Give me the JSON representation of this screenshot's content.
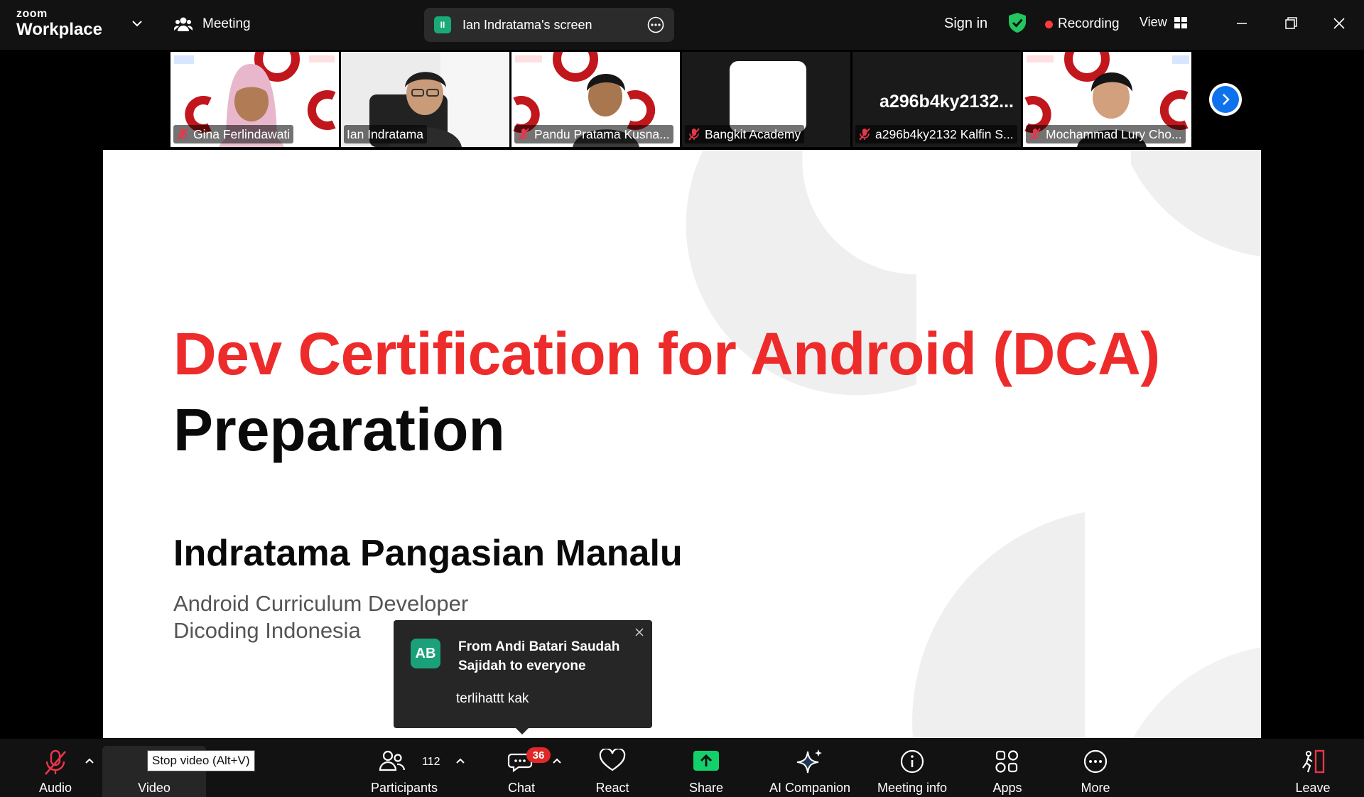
{
  "topbar": {
    "logo_line1": "zoom",
    "logo_line2": "Workplace",
    "meeting_label": "Meeting",
    "share_badge": "II",
    "share_title": "Ian Indratama's screen",
    "sign_in": "Sign in",
    "recording": "Recording",
    "view": "View",
    "colors": {
      "recording_dot": "#ff3a3a",
      "shield": "#22c55e",
      "share_badge": "#1aaa78"
    }
  },
  "thumbnails": [
    {
      "name": "Gina Ferlindawati",
      "muted": true,
      "active": false
    },
    {
      "name": "Ian Indratama",
      "muted": false,
      "active": true
    },
    {
      "name": "Pandu Pratama Kusna...",
      "muted": true,
      "active": false
    },
    {
      "name": "Bangkit Academy",
      "muted": true,
      "active": false
    },
    {
      "name": "a296b4ky2132 Kalfin S...",
      "muted": true,
      "active": false,
      "big_label": "a296b4ky2132..."
    },
    {
      "name": "Mochammad Lury Cho...",
      "muted": true,
      "active": false
    }
  ],
  "slide": {
    "title_line1": "Dev Certification for Android (DCA)",
    "title_line2": "Preparation",
    "presenter": "Indratama Pangasian Manalu",
    "role": "Android Curriculum Developer",
    "org": "Dicoding Indonesia",
    "colors": {
      "title_red": "#ee2b2b"
    }
  },
  "chat_toast": {
    "avatar_initials": "AB",
    "from": "From Andi Batari Saudah Sajidah to everyone",
    "message": "terlihattt kak"
  },
  "toolbar": {
    "audio": "Audio",
    "video": "Video",
    "video_tooltip": "Stop video (Alt+V)",
    "participants": "Participants",
    "participants_count": "112",
    "chat": "Chat",
    "chat_badge": "36",
    "react": "React",
    "share": "Share",
    "ai_companion": "AI Companion",
    "meeting_info": "Meeting info",
    "apps": "Apps",
    "more": "More",
    "leave": "Leave",
    "colors": {
      "share_green": "#12d16b",
      "mute_red": "#e8364a",
      "leave_red": "#e8364a"
    }
  }
}
